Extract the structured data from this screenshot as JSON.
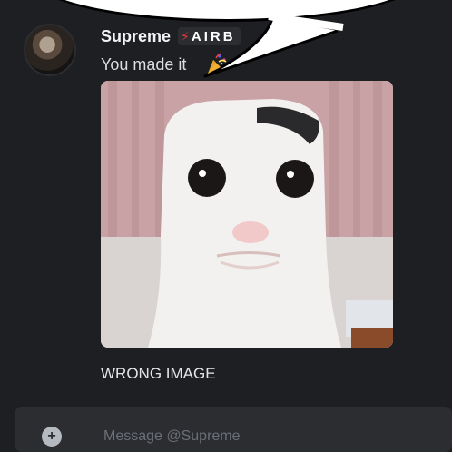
{
  "message": {
    "author": "Supreme",
    "tag": "AIRB",
    "tag_icon": "lightning-bolt-icon",
    "text": "You made it",
    "emoji": "party-popper-icon",
    "caption": "WRONG IMAGE",
    "attachment": "cat-face-image"
  },
  "composer": {
    "placeholder": "Message @Supreme",
    "plus_icon": "add-attachment-icon"
  },
  "colors": {
    "background": "#1e1f22",
    "composer": "#2b2d31",
    "username": "#f2f3f5",
    "text": "#dbdee1",
    "tag_icon": "#e23b3b"
  }
}
